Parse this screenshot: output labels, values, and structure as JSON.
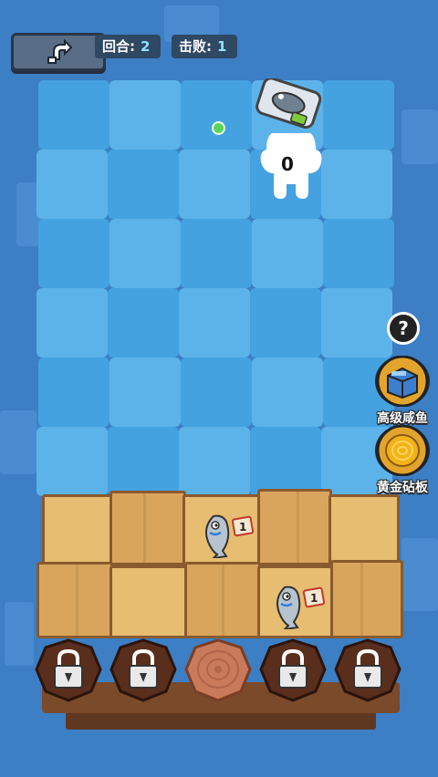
{
  "hud": {
    "back_icon": "return-arrow-icon",
    "round_label": "回合:",
    "round_value": "2",
    "kills_label": "击败:",
    "kills_value": "1"
  },
  "enemy": {
    "count": "0",
    "icon": "fish-card-icon"
  },
  "side_shop": {
    "help_glyph": "?",
    "items": [
      {
        "label": "高级咸鱼",
        "icon": "premium-fish-crate-icon"
      },
      {
        "label": "黄金砧板",
        "icon": "golden-chopping-board-icon"
      }
    ]
  },
  "stall": {
    "fish": [
      {
        "level": "1",
        "icon": "salted-fish-icon"
      },
      {
        "level": "1",
        "icon": "salted-fish-icon"
      }
    ],
    "slots": [
      {
        "state": "locked",
        "icon": "lock-icon"
      },
      {
        "state": "locked",
        "icon": "lock-icon"
      },
      {
        "state": "open",
        "icon": "wood-stump-icon"
      },
      {
        "state": "locked",
        "icon": "lock-icon"
      },
      {
        "state": "locked",
        "icon": "lock-icon"
      }
    ]
  },
  "colors": {
    "background": "#3c7fc4",
    "tile_light": "#5cb3ea",
    "tile_dark": "#45a2e0",
    "wood": "#e7bd72",
    "accent_number": "#8fe3ff"
  }
}
